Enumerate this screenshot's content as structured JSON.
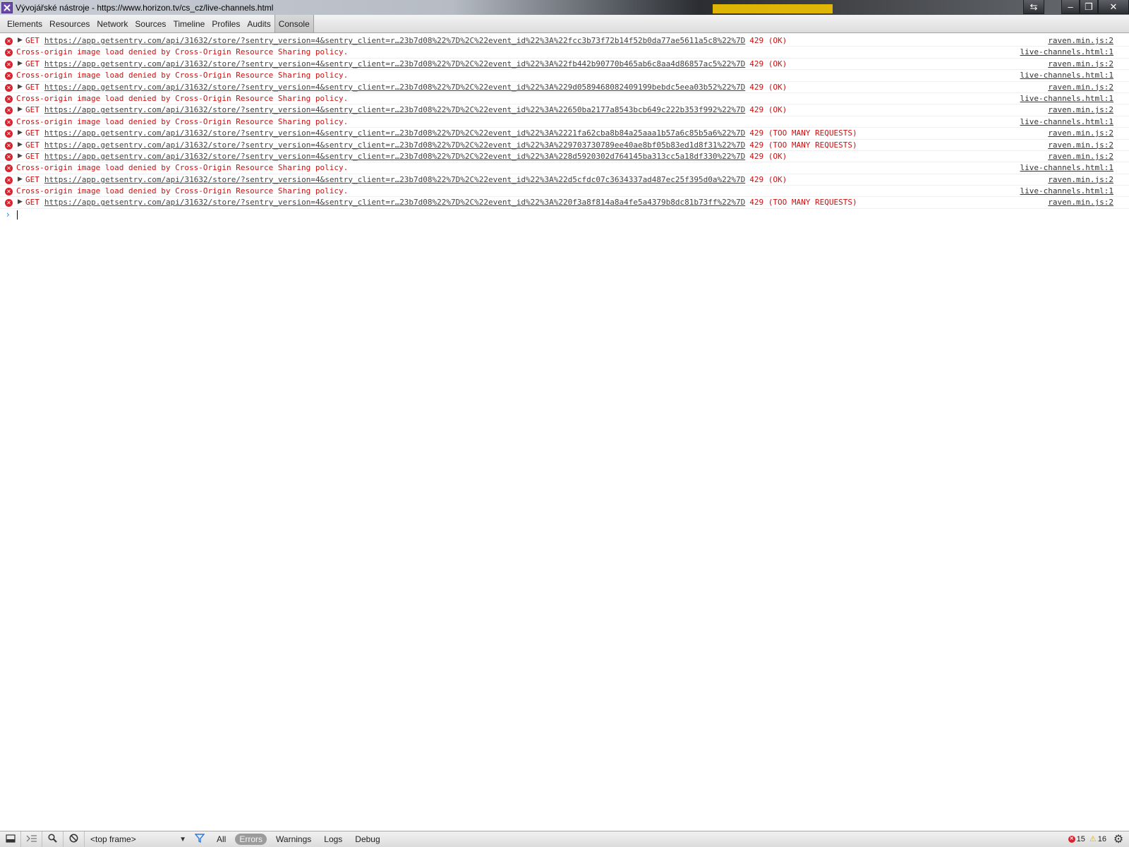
{
  "window": {
    "title": "Vývojářské nástroje - https://www.horizon.tv/cs_cz/live-channels.html",
    "swap_glyph": "⇆",
    "min_glyph": "–",
    "max_glyph": "❐",
    "close_glyph": "✕"
  },
  "tabs": [
    {
      "label": "Elements",
      "active": false
    },
    {
      "label": "Resources",
      "active": false
    },
    {
      "label": "Network",
      "active": false
    },
    {
      "label": "Sources",
      "active": false
    },
    {
      "label": "Timeline",
      "active": false
    },
    {
      "label": "Profiles",
      "active": false
    },
    {
      "label": "Audits",
      "active": false
    },
    {
      "label": "Console",
      "active": true
    }
  ],
  "console": {
    "error_glyph": "✕",
    "expand_glyph": "▶",
    "prompt_glyph": "›",
    "rows": [
      {
        "type": "net",
        "method": "GET",
        "url": "https://app.getsentry.com/api/31632/store/?sentry_version=4&sentry_client=r…23b7d08%22%7D%2C%22event_id%22%3A%22fcc3b73f72b14f52b0da77ae5611a5c8%22%7D",
        "status": "429 (OK)",
        "source": "raven.min.js:2"
      },
      {
        "type": "msg",
        "text": "Cross-origin image load denied by Cross-Origin Resource Sharing policy.",
        "source": "live-channels.html:1"
      },
      {
        "type": "net",
        "method": "GET",
        "url": "https://app.getsentry.com/api/31632/store/?sentry_version=4&sentry_client=r…23b7d08%22%7D%2C%22event_id%22%3A%22fb442b90770b465ab6c8aa4d86857ac5%22%7D",
        "status": "429 (OK)",
        "source": "raven.min.js:2"
      },
      {
        "type": "msg",
        "text": "Cross-origin image load denied by Cross-Origin Resource Sharing policy.",
        "source": "live-channels.html:1"
      },
      {
        "type": "net",
        "method": "GET",
        "url": "https://app.getsentry.com/api/31632/store/?sentry_version=4&sentry_client=r…23b7d08%22%7D%2C%22event_id%22%3A%229d0589468082409199bebdc5eea03b52%22%7D",
        "status": "429 (OK)",
        "source": "raven.min.js:2"
      },
      {
        "type": "msg",
        "text": "Cross-origin image load denied by Cross-Origin Resource Sharing policy.",
        "source": "live-channels.html:1"
      },
      {
        "type": "net",
        "method": "GET",
        "url": "https://app.getsentry.com/api/31632/store/?sentry_version=4&sentry_client=r…23b7d08%22%7D%2C%22event_id%22%3A%22650ba2177a8543bcb649c222b353f992%22%7D",
        "status": "429 (OK)",
        "source": "raven.min.js:2"
      },
      {
        "type": "msg",
        "text": "Cross-origin image load denied by Cross-Origin Resource Sharing policy.",
        "source": "live-channels.html:1"
      },
      {
        "type": "net",
        "method": "GET",
        "url": "https://app.getsentry.com/api/31632/store/?sentry_version=4&sentry_client=r…23b7d08%22%7D%2C%22event_id%22%3A%2221fa62cba8b84a25aaa1b57a6c85b5a6%22%7D",
        "status": "429 (TOO MANY REQUESTS)",
        "source": "raven.min.js:2"
      },
      {
        "type": "net",
        "method": "GET",
        "url": "https://app.getsentry.com/api/31632/store/?sentry_version=4&sentry_client=r…23b7d08%22%7D%2C%22event_id%22%3A%229703730789ee40ae8bf05b83ed1d8f31%22%7D",
        "status": "429 (TOO MANY REQUESTS)",
        "source": "raven.min.js:2"
      },
      {
        "type": "net",
        "method": "GET",
        "url": "https://app.getsentry.com/api/31632/store/?sentry_version=4&sentry_client=r…23b7d08%22%7D%2C%22event_id%22%3A%228d5920302d764145ba313cc5a18df330%22%7D",
        "status": "429 (OK)",
        "source": "raven.min.js:2"
      },
      {
        "type": "msg",
        "text": "Cross-origin image load denied by Cross-Origin Resource Sharing policy.",
        "source": "live-channels.html:1"
      },
      {
        "type": "net",
        "method": "GET",
        "url": "https://app.getsentry.com/api/31632/store/?sentry_version=4&sentry_client=r…23b7d08%22%7D%2C%22event_id%22%3A%22d5cfdc07c3634337ad487ec25f395d0a%22%7D",
        "status": "429 (OK)",
        "source": "raven.min.js:2"
      },
      {
        "type": "msg",
        "text": "Cross-origin image load denied by Cross-Origin Resource Sharing policy.",
        "source": "live-channels.html:1"
      },
      {
        "type": "net",
        "method": "GET",
        "url": "https://app.getsentry.com/api/31632/store/?sentry_version=4&sentry_client=r…23b7d08%22%7D%2C%22event_id%22%3A%220f3a8f814a8a4fe5a4379b8dc81b73ff%22%7D",
        "status": "429 (TOO MANY REQUESTS)",
        "source": "raven.min.js:2"
      }
    ]
  },
  "statusbar": {
    "frame_select": "<top frame>",
    "levels": [
      {
        "label": "All",
        "active": false
      },
      {
        "label": "Errors",
        "active": true
      },
      {
        "label": "Warnings",
        "active": false
      },
      {
        "label": "Logs",
        "active": false
      },
      {
        "label": "Debug",
        "active": false
      }
    ],
    "error_count": "15",
    "warning_count": "16",
    "warning_glyph": "⚠",
    "gear_glyph": "⚙"
  },
  "colors": {
    "error_red": "#cc1111",
    "tab_active_bg": "#c8c8c8",
    "prompt_blue": "#2a7ae2"
  }
}
